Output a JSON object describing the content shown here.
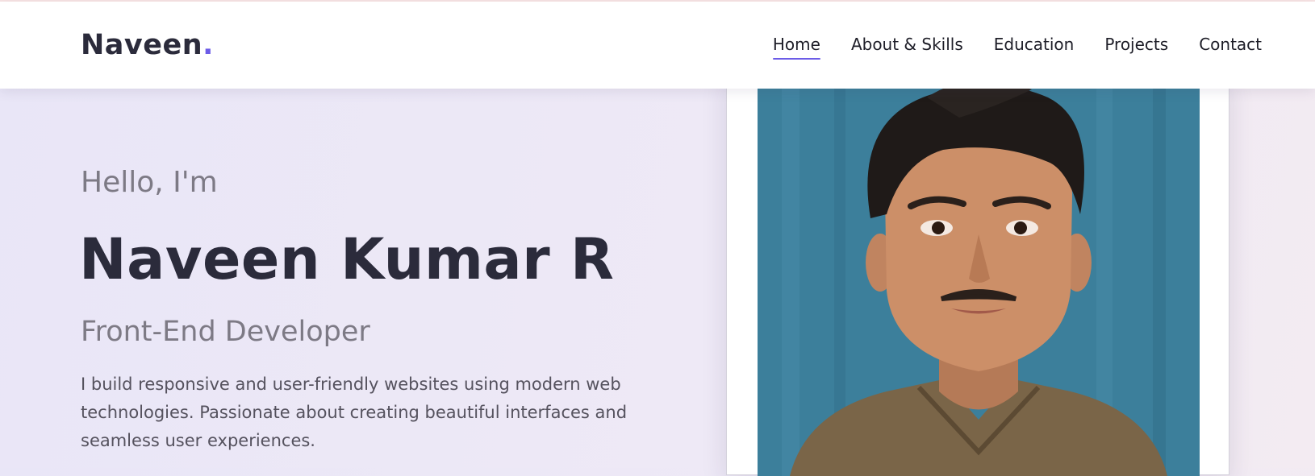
{
  "navbar": {
    "logo_text": "Naveen",
    "logo_dot": ".",
    "links": [
      {
        "label": "Home",
        "active": true
      },
      {
        "label": "About & Skills",
        "active": false
      },
      {
        "label": "Education",
        "active": false
      },
      {
        "label": "Projects",
        "active": false
      },
      {
        "label": "Contact",
        "active": false
      }
    ]
  },
  "hero": {
    "greeting": "Hello, I'm",
    "name": "Naveen Kumar R",
    "role": "Front-End Developer",
    "bio": "I build responsive and user-friendly websites using modern web technologies. Passionate about creating beautiful interfaces and seamless user experiences."
  },
  "colors": {
    "accent": "#6c5ce7",
    "heading": "#2b2b3b",
    "muted": "#7d7a85"
  },
  "icons": {
    "profile_photo": "profile-portrait"
  }
}
